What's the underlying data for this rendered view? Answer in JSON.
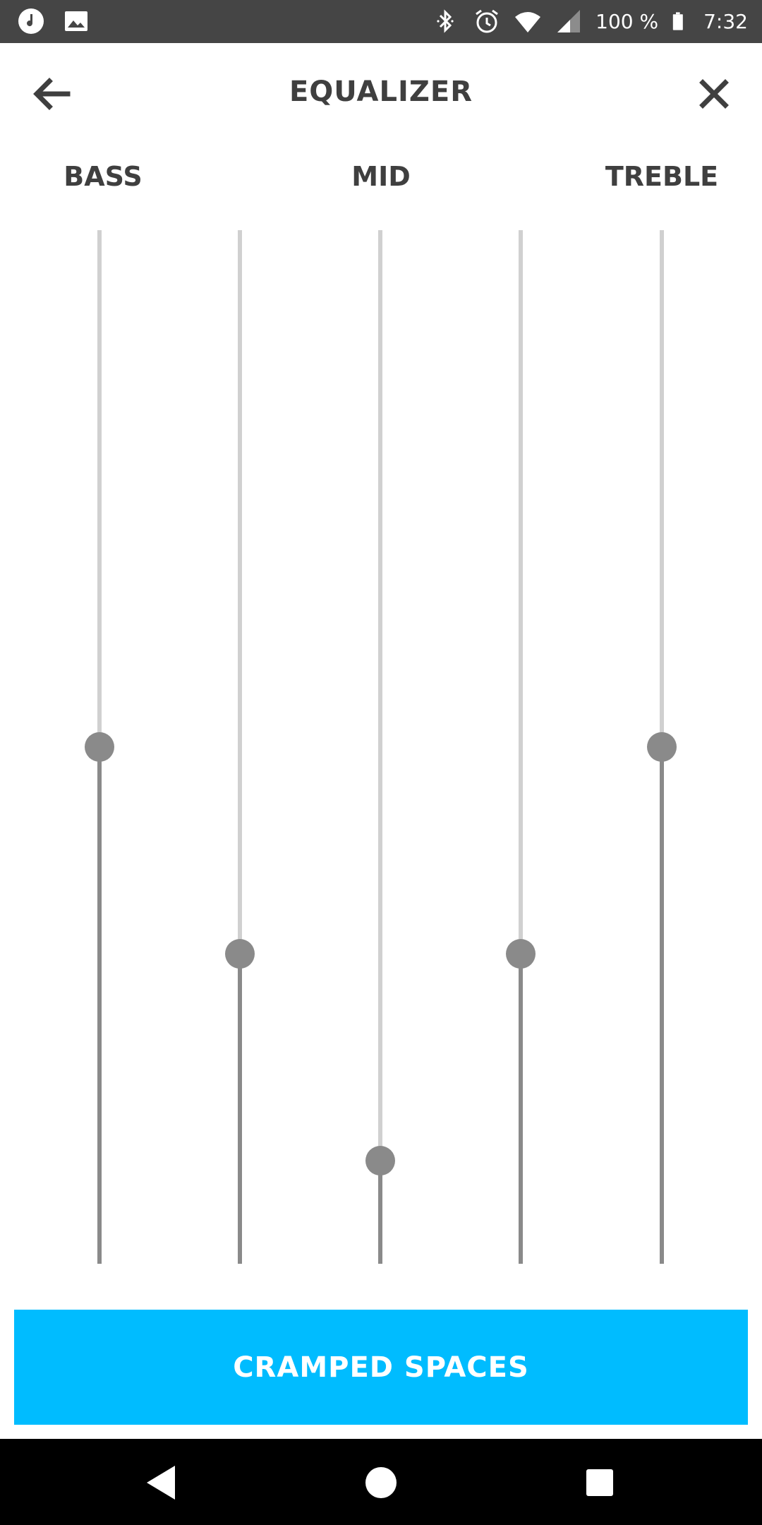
{
  "status_bar": {
    "battery_text": "100 %",
    "time": "7:32",
    "icons": [
      "music-note-icon",
      "image-icon",
      "bluetooth-icon",
      "alarm-icon",
      "wifi-icon",
      "cell-signal-icon",
      "battery-icon"
    ]
  },
  "header": {
    "title": "EQUALIZER",
    "back_icon": "arrow-left-icon",
    "close_icon": "close-icon"
  },
  "bands": [
    {
      "label": "BASS"
    },
    {
      "label": "MID"
    },
    {
      "label": "TREBLE"
    }
  ],
  "sliders": [
    {
      "name": "band-1",
      "level": 0.5
    },
    {
      "name": "band-2",
      "level": 0.3
    },
    {
      "name": "band-3",
      "level": 0.1
    },
    {
      "name": "band-4",
      "level": 0.3
    },
    {
      "name": "band-5",
      "level": 0.5
    }
  ],
  "preset_button": {
    "label": "CRAMPED SPACES"
  },
  "nav_bar": {
    "icons": [
      "back-triangle-icon",
      "home-circle-icon",
      "recents-square-icon"
    ]
  },
  "colors": {
    "accent": "#00bcff",
    "slider_track": "#d0d0d0",
    "slider_fill": "#8a8a8a",
    "text_dark": "#3f3f3f",
    "status_bar": "#454545"
  }
}
